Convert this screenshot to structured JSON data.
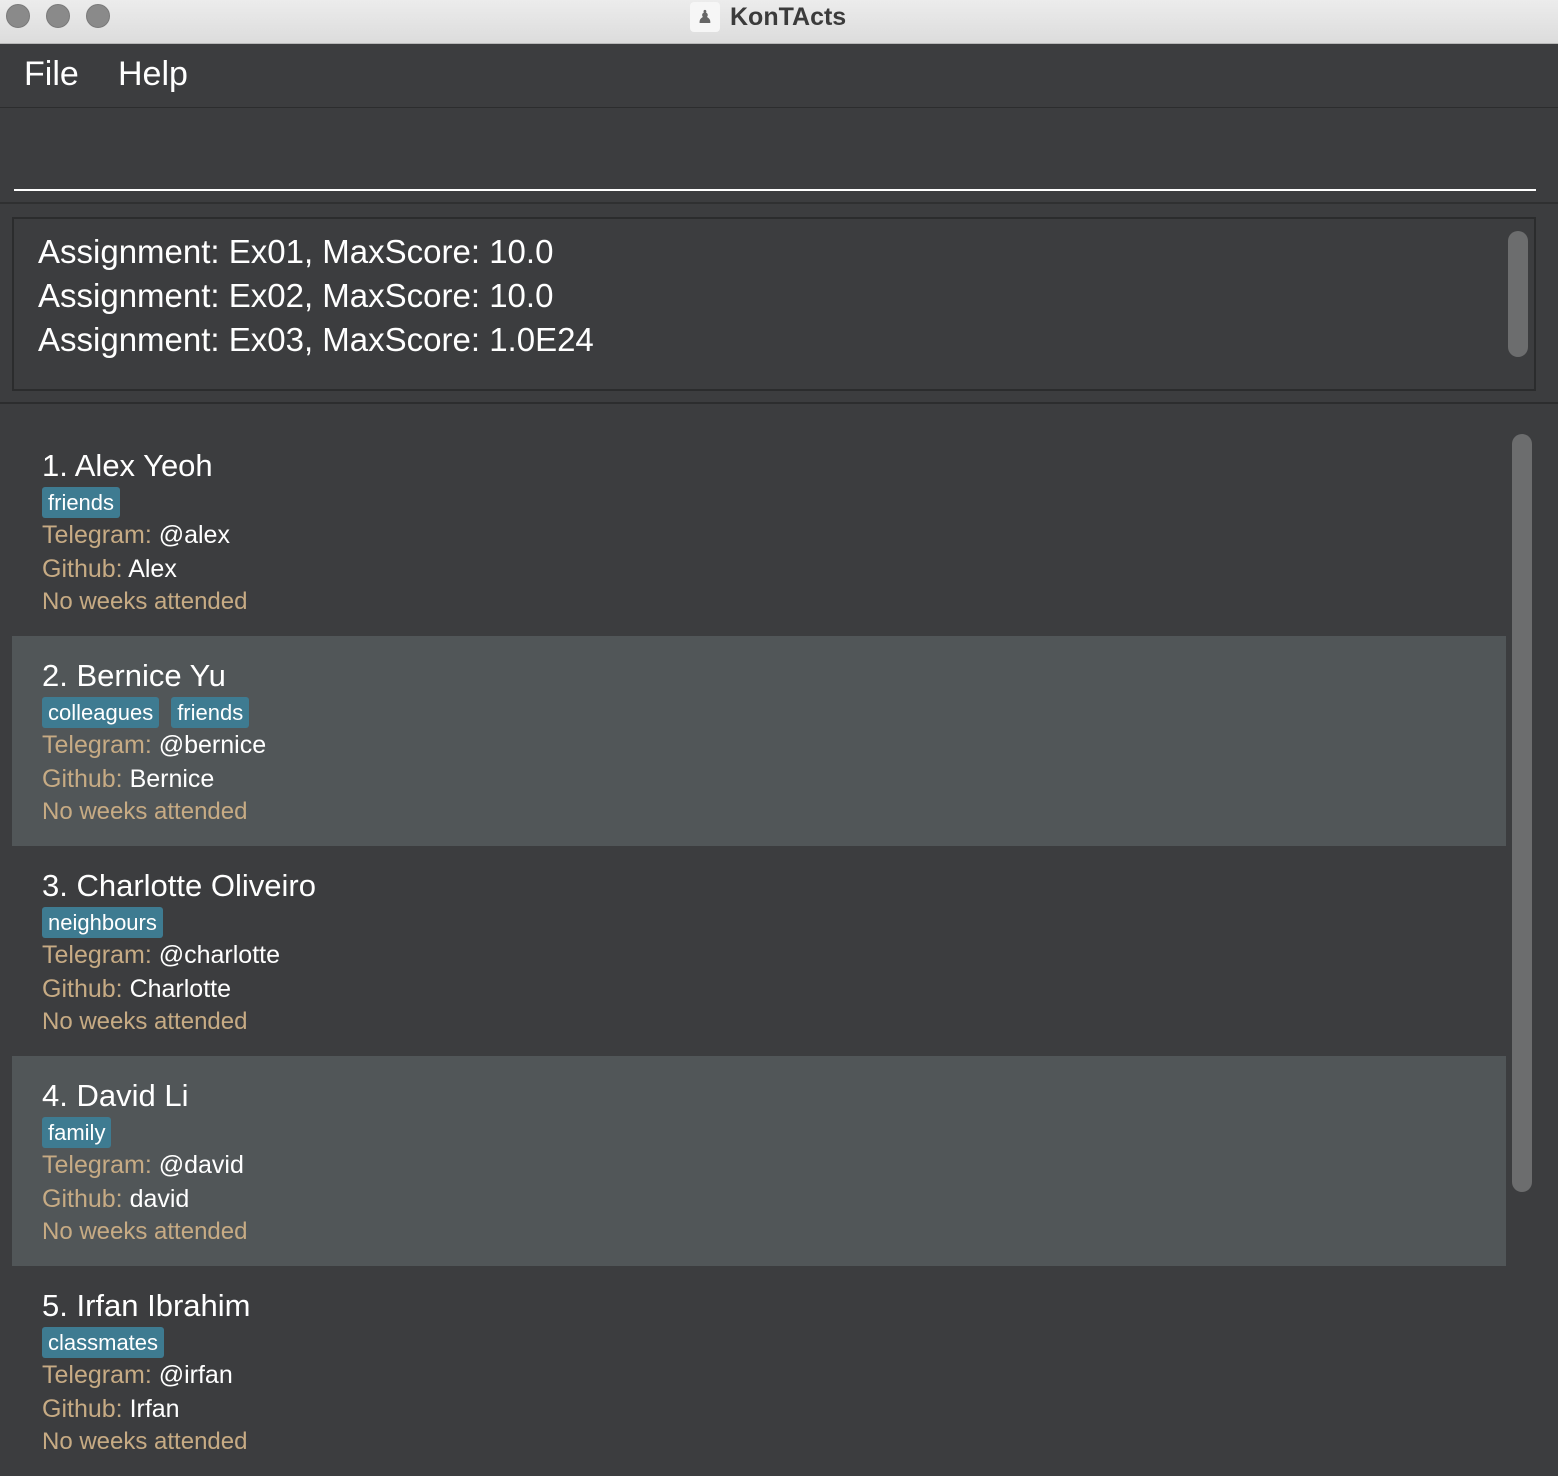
{
  "window": {
    "title": "KonTActs"
  },
  "menu": {
    "file": "File",
    "help": "Help"
  },
  "command": {
    "value": "",
    "placeholder": ""
  },
  "result": {
    "lines": [
      "Assignment: Ex01, MaxScore: 10.0",
      "Assignment: Ex02, MaxScore: 10.0",
      "Assignment: Ex03, MaxScore: 1.0E24"
    ]
  },
  "labels": {
    "telegram": "Telegram:",
    "github": "Github:"
  },
  "persons": [
    {
      "name": "1. Alex Yeoh",
      "tags": [
        "friends"
      ],
      "telegram": "@alex",
      "github": "Alex",
      "weeks": "No weeks attended"
    },
    {
      "name": "2. Bernice Yu",
      "tags": [
        "colleagues",
        "friends"
      ],
      "telegram": "@bernice",
      "github": "Bernice",
      "weeks": "No weeks attended"
    },
    {
      "name": "3. Charlotte Oliveiro",
      "tags": [
        "neighbours"
      ],
      "telegram": "@charlotte",
      "github": "Charlotte",
      "weeks": "No weeks attended"
    },
    {
      "name": "4. David Li",
      "tags": [
        "family"
      ],
      "telegram": "@david",
      "github": "david",
      "weeks": "No weeks attended"
    },
    {
      "name": "5. Irfan Ibrahim",
      "tags": [
        "classmates"
      ],
      "telegram": "@irfan",
      "github": "Irfan",
      "weeks": "No weeks attended"
    }
  ],
  "colors": {
    "background": "#3c3d3f",
    "card_alt": "#515658",
    "tag": "#3e7b91",
    "label": "#c7ab84"
  }
}
